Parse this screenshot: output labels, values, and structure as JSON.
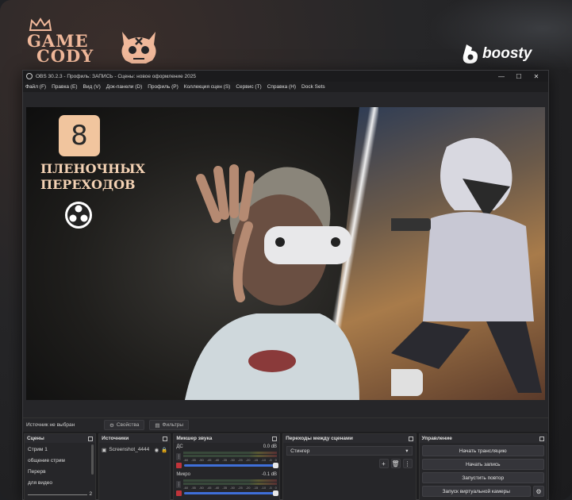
{
  "branding": {
    "logo_text_line1": "GAME",
    "logo_text_line2": "CODY",
    "boosty_text": "boosty"
  },
  "window": {
    "title": "OBS 30.2.3 - Профиль: ЗАПИСЬ - Сцены: новое оформление 2025",
    "minimize": "—",
    "maximize": "☐",
    "close": "✕"
  },
  "menu": {
    "items": [
      "Файл (F)",
      "Правка (E)",
      "Вид (V)",
      "Док-панели (D)",
      "Профиль (P)",
      "Коллекция сцен (S)",
      "Сервис (T)",
      "Справка (H)",
      "Dock Sets"
    ]
  },
  "preview": {
    "badge_number": "8",
    "promo_line1": "ПЛЕНОЧНЫХ",
    "promo_line2": "ПЕРЕХОДОВ"
  },
  "sourcebar": {
    "no_source": "Источник не выбран",
    "properties": "Свойства",
    "filters": "Фильтры"
  },
  "docks": {
    "scenes": {
      "title": "Сцены",
      "items": [
        "Стрим 1",
        "общение стрим",
        "Перерв",
        "для видео",
        "2"
      ]
    },
    "sources": {
      "title": "Источники",
      "items": [
        "Screenshot_4444"
      ]
    },
    "mixer": {
      "title": "Микшер звука",
      "channels": [
        {
          "name": "ДС",
          "db": "0.0 dB"
        },
        {
          "name": "Микро",
          "db": "-0.1 dB"
        }
      ],
      "scale": [
        "-60",
        "-55",
        "-50",
        "-45",
        "-40",
        "-35",
        "-30",
        "-25",
        "-20",
        "-15",
        "-10",
        "-5",
        "0"
      ]
    },
    "transitions": {
      "title": "Переходы между сценами",
      "selected": "Стингер"
    },
    "controls": {
      "title": "Управление",
      "start_stream": "Начать трансляцию",
      "start_record": "Начать запись",
      "start_replay": "Запустить повтор",
      "start_vcam": "Запуск виртуальной камеры"
    }
  },
  "colors": {
    "accent_peach": "#f1c59e",
    "fader_blue": "#3f6fd8",
    "mute_red": "#c0343a"
  }
}
